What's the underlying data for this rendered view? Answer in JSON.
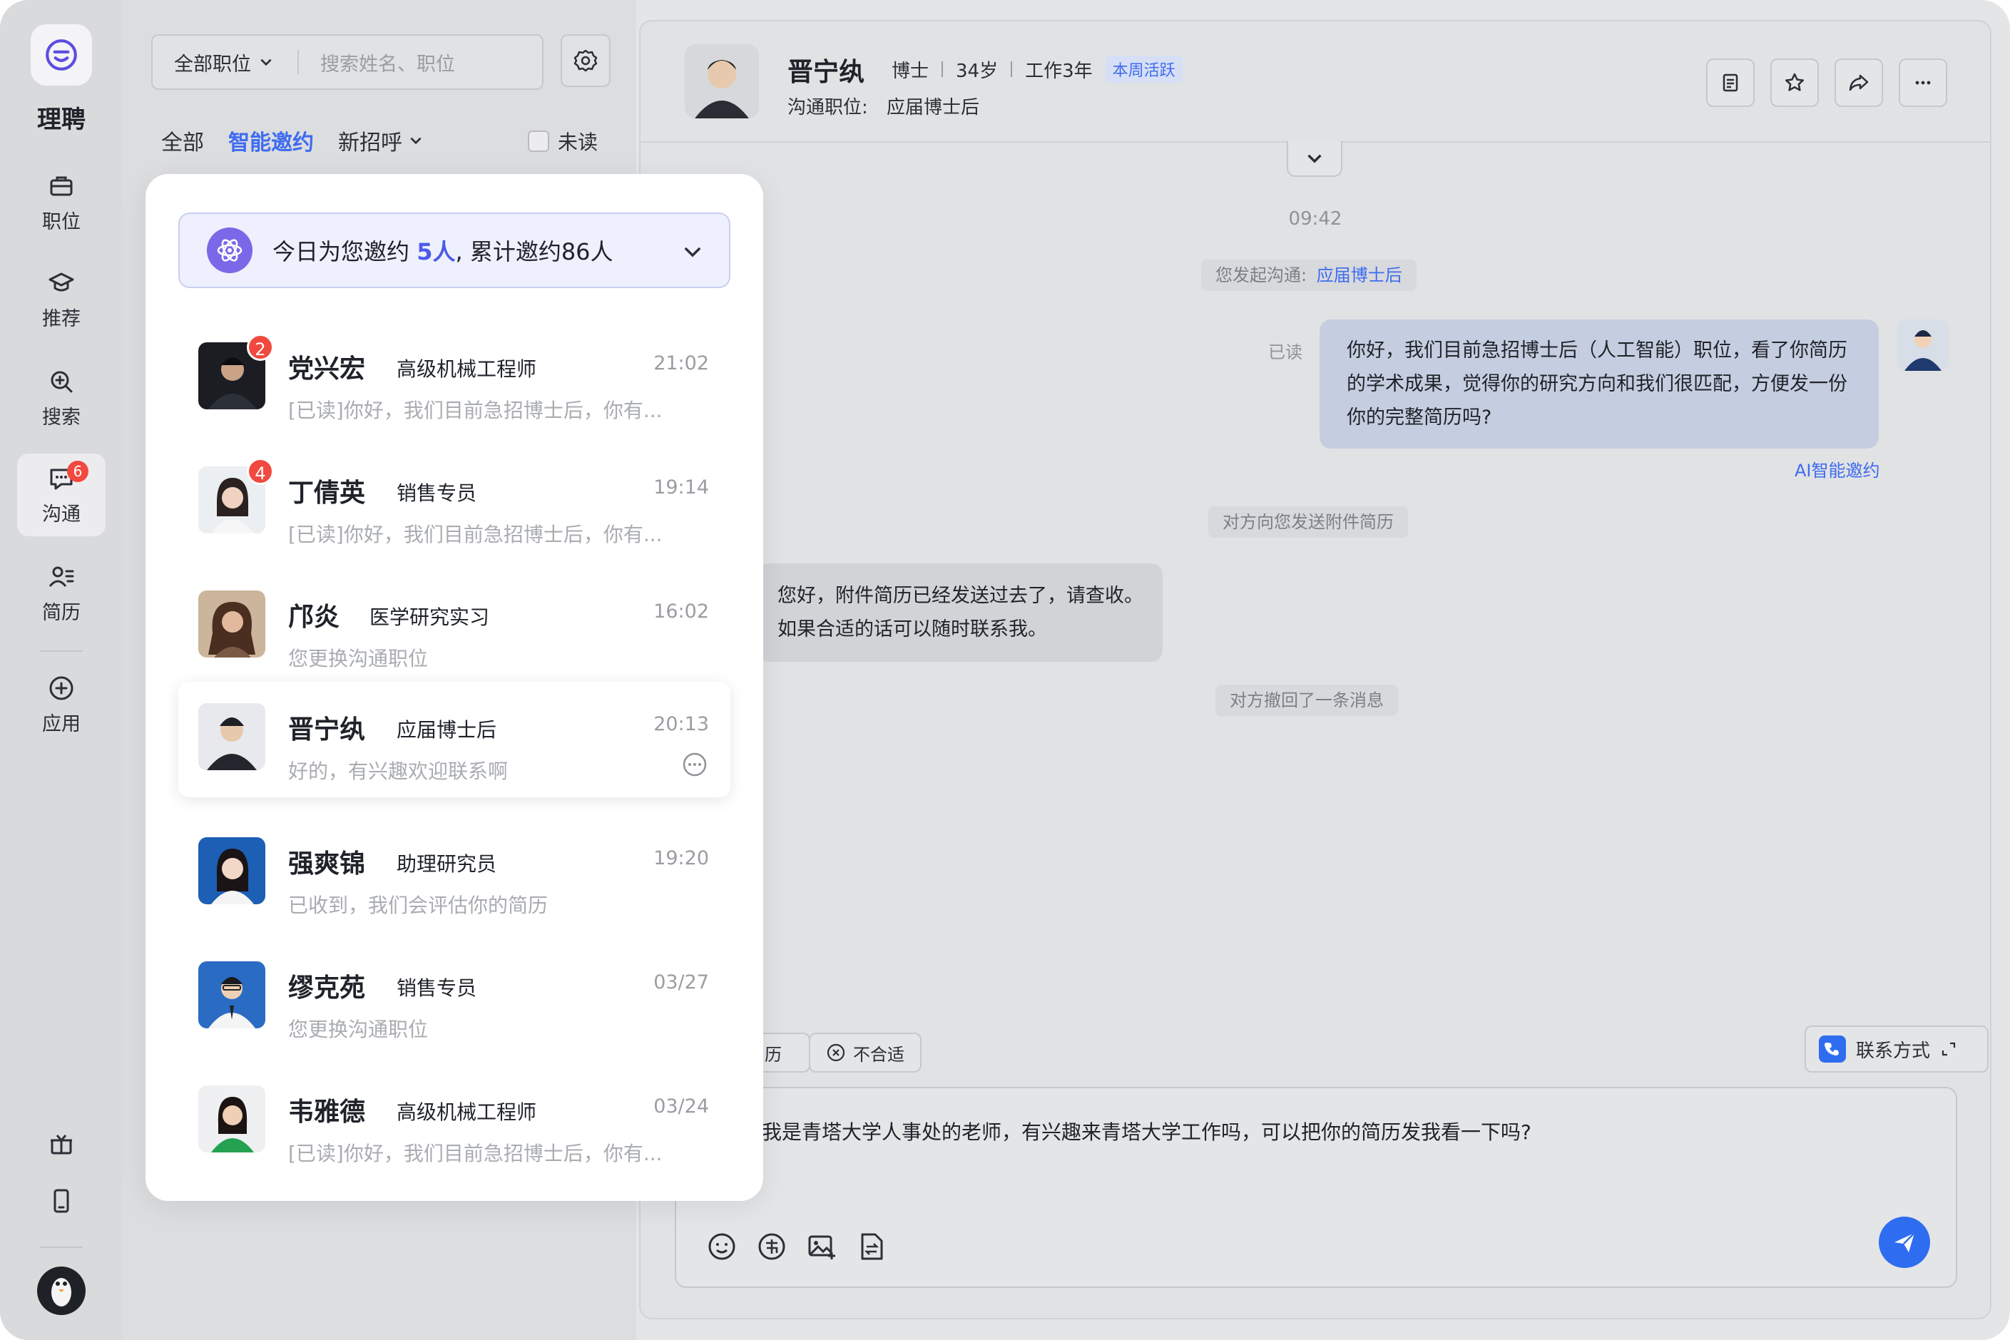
{
  "app": {
    "name": "理聘"
  },
  "nav": {
    "items": [
      {
        "label": "职位"
      },
      {
        "label": "推荐"
      },
      {
        "label": "搜索"
      },
      {
        "label": "沟通",
        "badge": "6"
      },
      {
        "label": "简历"
      },
      {
        "label": "应用"
      }
    ]
  },
  "filter": {
    "position_select": "全部职位",
    "search_placeholder": "搜索姓名、职位"
  },
  "tabs": {
    "all": "全部",
    "smart": "智能邀约",
    "new": "新招呼",
    "unread": "未读"
  },
  "banner": {
    "prefix": "今日为您邀约 ",
    "today": "5人",
    "suffix": ", 累计邀约86人"
  },
  "conversations": [
    {
      "name": "党兴宏",
      "role": "高级机械工程师",
      "time": "21:02",
      "preview": "[已读]你好，我们目前急招博士后，你有...",
      "badge": "2"
    },
    {
      "name": "丁倩英",
      "role": "销售专员",
      "time": "19:14",
      "preview": "[已读]你好，我们目前急招博士后，你有...",
      "badge": "4"
    },
    {
      "name": "邝炎",
      "role": "医学研究实习",
      "time": "16:02",
      "preview": "您更换沟通职位"
    },
    {
      "name": "晋宁纨",
      "role": "应届博士后",
      "time": "20:13",
      "preview": "好的，有兴趣欢迎联系啊"
    },
    {
      "name": "强爽锦",
      "role": "助理研究员",
      "time": "19:20",
      "preview": "已收到，我们会评估你的简历"
    },
    {
      "name": "缪克苑",
      "role": "销售专员",
      "time": "03/27",
      "preview": "您更换沟通职位"
    },
    {
      "name": "韦雅德",
      "role": "高级机械工程师",
      "time": "03/24",
      "preview": "[已读]你好，我们目前急招博士后，你有..."
    }
  ],
  "chat": {
    "name": "晋宁纨",
    "degree": "博士",
    "age": "34岁",
    "experience": "工作3年",
    "active_tag": "本周活跃",
    "job_label": "沟通职位:",
    "job": "应届博士后",
    "time": "09:42",
    "sys_start_prefix": "您发起沟通:",
    "sys_start_link": "应届博士后",
    "read_flag": "已读",
    "outgoing": "你好，我们目前急招博士后（人工智能）职位，看了你简历的学术成果，觉得你的研究方向和我们很匹配，方便发一份你的完整简历吗?",
    "ai_tag": "AI智能邀约",
    "sys_resume": "对方向您发送附件简历",
    "incoming": "您好，附件简历已经发送过去了，请查收。如果合适的话可以随时联系我。",
    "sys_recall": "对方撤回了一条消息",
    "chip_resume": "历",
    "chip_reject": "不合适",
    "contact": "联系方式",
    "draft": "我是青塔大学人事处的老师，有兴趣来青塔大学工作吗，可以把你的简历发我看一下吗?"
  }
}
